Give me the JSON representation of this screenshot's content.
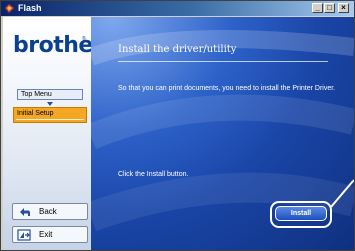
{
  "window": {
    "title": "Flash",
    "minimize_label": "_",
    "maximize_label": "□",
    "close_label": "×"
  },
  "sidebar": {
    "logo_text": "brother",
    "logo_mark": "®",
    "top_menu_label": "Top Menu",
    "current_step_label": "Initial Setup",
    "back_label": "Back",
    "exit_label": "Exit"
  },
  "main": {
    "heading": "Install the driver/utility",
    "description": "So that you can print documents, you need to install the Printer Driver.",
    "hint": "Click the Install button.",
    "install_label": "Install"
  },
  "colors": {
    "accent_blue": "#1a46a8",
    "highlight_orange": "#f5a623",
    "brand_blue": "#0b3f8f"
  }
}
